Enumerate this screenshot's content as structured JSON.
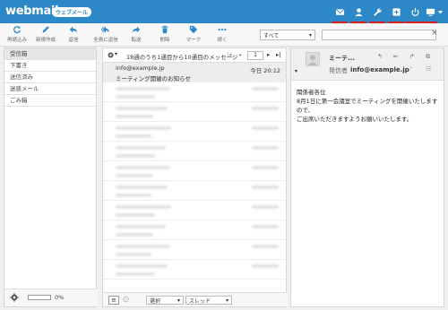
{
  "header": {
    "logo": "webmail",
    "badge": "ウェブメール"
  },
  "callouts": [
    "1",
    "2",
    "3",
    "4",
    "5",
    "6"
  ],
  "toolbar": {
    "refresh": "再読込み",
    "compose": "新規作成",
    "reply": "返信",
    "reply_all": "全員に返信",
    "forward": "転送",
    "delete": "削除",
    "mark": "マーク",
    "more": "続く"
  },
  "filter": {
    "value": "すべて"
  },
  "folders": [
    "受信箱",
    "下書き",
    "送信済み",
    "迷惑メール",
    "ごみ箱"
  ],
  "quota": {
    "percent_text": "0%",
    "value": 0
  },
  "list": {
    "count_text": "18通のうち1通目から10通目のメッセージ",
    "page": "1",
    "selected": {
      "from": "info@example.jp",
      "subject": "ミーティング開催のお知らせ",
      "date": "今日 20:12"
    }
  },
  "list_footer": {
    "select": "選択",
    "thread": "スレッド"
  },
  "preview": {
    "subject": "ミーテ...",
    "from_label": "発信者",
    "from": "info@example.jp",
    "body": [
      "関係者各位",
      "8月1日に第一会議室でミーティングを開催いたしますので、",
      "ご出席いただきますようお願いいたします。"
    ]
  }
}
